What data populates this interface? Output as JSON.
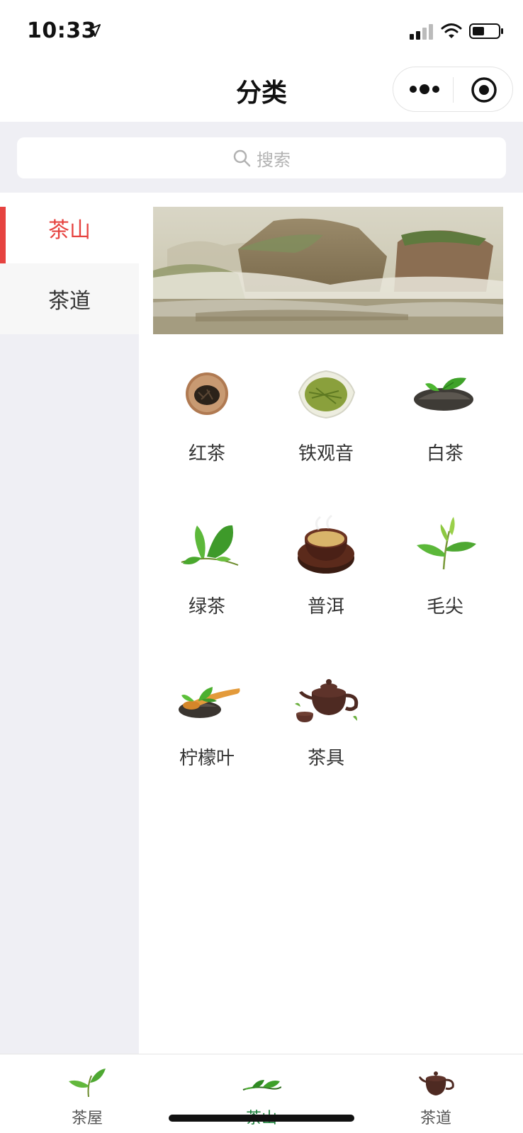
{
  "status": {
    "time": "10:33",
    "icons": [
      "location-arrow-icon",
      "cellular-signal-icon",
      "wifi-icon",
      "battery-icon"
    ]
  },
  "nav": {
    "title": "分类",
    "icons": [
      "more-dots-icon",
      "target-circle-icon"
    ]
  },
  "search": {
    "placeholder": "搜索",
    "icon": "search-icon"
  },
  "sidebar": {
    "items": [
      {
        "label": "茶山",
        "active": true
      },
      {
        "label": "茶道",
        "active": false
      }
    ]
  },
  "content": {
    "banner": "mountain-landscape-banner",
    "categories": [
      {
        "label": "红茶",
        "icon": "black-tea-icon"
      },
      {
        "label": "铁观音",
        "icon": "tieguanyin-icon"
      },
      {
        "label": "白茶",
        "icon": "white-tea-icon"
      },
      {
        "label": "绿茶",
        "icon": "green-tea-leaf-icon"
      },
      {
        "label": "普洱",
        "icon": "puer-cup-icon"
      },
      {
        "label": "毛尖",
        "icon": "maojian-leaf-icon"
      },
      {
        "label": "柠檬叶",
        "icon": "lemon-leaf-spoon-icon"
      },
      {
        "label": "茶具",
        "icon": "teapot-icon"
      }
    ]
  },
  "tabbar": {
    "tabs": [
      {
        "label": "茶屋",
        "icon": "tea-sprout-icon",
        "active": false
      },
      {
        "label": "茶山",
        "icon": "tea-leaves-icon",
        "active": true
      },
      {
        "label": "茶道",
        "icon": "teapot-tab-icon",
        "active": false
      }
    ]
  },
  "colors": {
    "accent": "#e64340",
    "tab_active": "#1a7f3a",
    "background": "#efeff4"
  }
}
